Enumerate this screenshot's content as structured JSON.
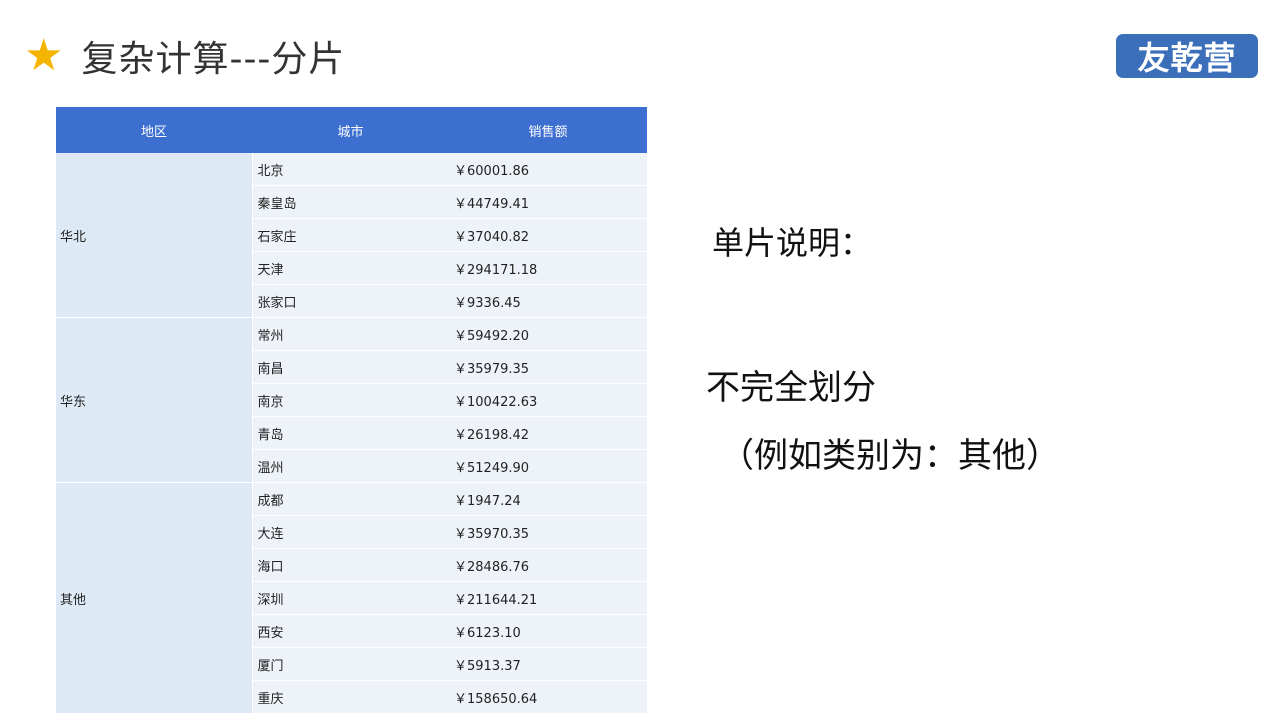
{
  "header": {
    "star_icon": "star-icon",
    "title": "复杂计算---分片"
  },
  "logo": {
    "text": "友乾营",
    "color": "#3c6fba"
  },
  "table": {
    "columns": [
      "地区",
      "城市",
      "销售额"
    ],
    "groups": [
      {
        "region": "华北",
        "rows": [
          {
            "city": "北京",
            "sales": "￥60001.86"
          },
          {
            "city": "秦皇岛",
            "sales": "￥44749.41"
          },
          {
            "city": "石家庄",
            "sales": "￥37040.82"
          },
          {
            "city": "天津",
            "sales": "￥294171.18"
          },
          {
            "city": "张家口",
            "sales": "￥9336.45"
          }
        ]
      },
      {
        "region": "华东",
        "rows": [
          {
            "city": "常州",
            "sales": "￥59492.20"
          },
          {
            "city": "南昌",
            "sales": "￥35979.35"
          },
          {
            "city": "南京",
            "sales": "￥100422.63"
          },
          {
            "city": "青岛",
            "sales": "￥26198.42"
          },
          {
            "city": "温州",
            "sales": "￥51249.90"
          }
        ]
      },
      {
        "region": "其他",
        "rows": [
          {
            "city": "成都",
            "sales": "￥1947.24"
          },
          {
            "city": "大连",
            "sales": "￥35970.35"
          },
          {
            "city": "海口",
            "sales": "￥28486.76"
          },
          {
            "city": "深圳",
            "sales": "￥211644.21"
          },
          {
            "city": "西安",
            "sales": "￥6123.10"
          },
          {
            "city": "厦门",
            "sales": "￥5913.37"
          },
          {
            "city": "重庆",
            "sales": "￥158650.64"
          }
        ]
      }
    ]
  },
  "notes": {
    "line1": "单片说明：",
    "line2": "不完全划分",
    "line3": "（例如类别为：其他）"
  }
}
